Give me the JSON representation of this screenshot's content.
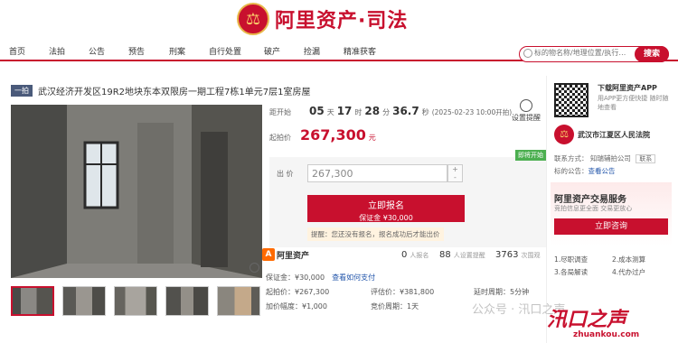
{
  "brand": {
    "title": "阿里资产·司法",
    "seal_glyph": "⚖"
  },
  "nav": [
    "首页",
    "法拍",
    "公告",
    "预告",
    "刑案",
    "自行处置",
    "破产",
    "捡漏",
    "精准获客"
  ],
  "search": {
    "placeholder": "标的物名称/地理位置/执行…",
    "button": "搜索"
  },
  "lot": {
    "badge": "一拍",
    "title": "武汉经济开发区19R2地块东本双限房一期工程7栋1单元7层1室房屋"
  },
  "countdown": {
    "label": "距开始",
    "days": "05",
    "d_unit": "天",
    "hours": "17",
    "h_unit": "时",
    "minutes": "28",
    "m_unit": "分",
    "seconds": "36.7",
    "s_unit": "秒",
    "date": "(2025-02-23 10:00开拍)",
    "reminder": "设置提醒"
  },
  "start_price": {
    "label": "起拍价",
    "value": "267,300",
    "unit": "元"
  },
  "bid": {
    "label": "出 价",
    "value": "267,300",
    "tag": "即将开始",
    "stepper_up": "+",
    "stepper_down": "-",
    "register": "立即报名",
    "deposit": "保证金 ¥30,000",
    "notice": "提醒：您还没有报名，报名成功后才能出价"
  },
  "stats": {
    "brand": "阿里资产",
    "apply_count": "0",
    "apply_label": "人报名",
    "remind_count": "88",
    "remind_label": "人设置提醒",
    "view_count": "3763",
    "view_label": "次围观"
  },
  "details": {
    "deposit": "保证金：¥30,000",
    "deposit_link": "查看如何支付",
    "start_price": "起拍价：¥267,300",
    "assessment": "评估价：¥381,800",
    "delay": "延时周期：5分钟",
    "increment": "加价幅度：¥1,000",
    "cycle": "竞价周期：1天"
  },
  "right": {
    "app_title": "下载阿里资产APP",
    "app_sub": "用APP更方便快捷 随时随地查看",
    "court_name": "武汉市江夏区人民法院",
    "court_contact": "联系方式：  知瑞辅拍公司",
    "court_contact_btn": "联系",
    "court_announce": "标的公告：",
    "court_announce_link": "查看公告",
    "service_title": "阿里资产交易服务",
    "service_sub": "竞拍信息更全面 交易更放心",
    "service_btn": "立即咨询",
    "features": [
      "1.尽职调查",
      "2.成本测算",
      "3.各局解读",
      "4.代办过户"
    ]
  },
  "watermark": {
    "left": "公众号 · 汛口之声",
    "brand": "汛口之声",
    "url": "zhuankou.com"
  }
}
